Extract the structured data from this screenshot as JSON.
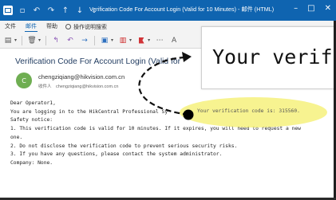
{
  "window": {
    "title": "Verification Code For Account Login (Valid for 10 Minutes) - 邮件 (HTML)",
    "controls": [
      "–",
      "□",
      "✕"
    ]
  },
  "menu": {
    "items": [
      "文件",
      "邮件",
      "帮助"
    ],
    "active_item": "邮件",
    "search_label": "操作说明搜索"
  },
  "toolbar": {
    "icons": [
      "save-icon",
      "delete-icon",
      "reply-icon",
      "reply-all-icon",
      "forward-icon",
      "move-icon",
      "category-icon",
      "flag-icon",
      "translate-icon"
    ]
  },
  "message": {
    "subject": "Verification Code For Account Login (Valid for",
    "avatar_letter": "C",
    "avatar_color": "#6fae52",
    "sender": "chengziqiang@hikvision.com.cn",
    "recipient_label": "收件人",
    "recipient": "chengziqiang@hikvision.com.cn",
    "body_lines": [
      "Dear Operator1,",
      "You are logging in to the HikCentral Professional Sy",
      "Safety notice:",
      "1. This verification code is valid for 10 minutes. If it expires, you will need to request a new",
      "one.",
      "2. Do not disclose the verification code to prevent serious security risks.",
      "3. If you have any questions, please contact the system administrator.",
      "Company: None."
    ]
  },
  "callout": {
    "zoom_text": "Your verifi",
    "highlight_text": "Your verification code is: 315560.",
    "highlight_color": "#f5f078"
  },
  "colors": {
    "titlebar": "#0f64b0",
    "subject": "#1f3a5f"
  }
}
